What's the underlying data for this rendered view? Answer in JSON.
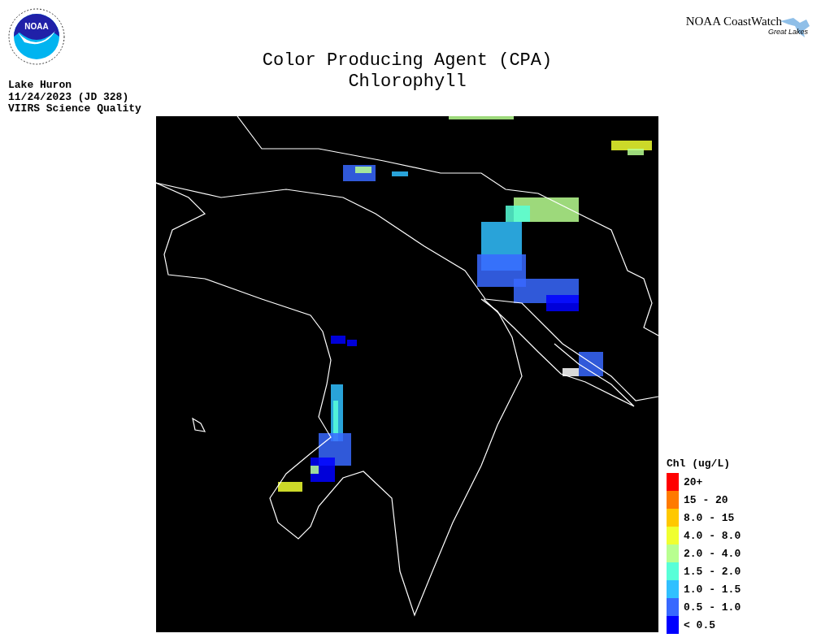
{
  "header": {
    "agency_logo_text": "NOAA",
    "title": "Color Producing Agent (CPA)",
    "subtitle": "Chlorophyll",
    "brand": "NOAA CoastWatch",
    "brand_sub": "Great Lakes"
  },
  "info": [
    "Lake Huron",
    "11/24/2023 (JD 328)",
    "VIIRS Science Quality"
  ],
  "legend": {
    "title": "Chl (ug/L)",
    "items": [
      {
        "label": "20+",
        "color": "#ff0000"
      },
      {
        "label": "15 - 20",
        "color": "#ff7a00"
      },
      {
        "label": "8.0 - 15",
        "color": "#ffc800"
      },
      {
        "label": "4.0 - 8.0",
        "color": "#f0ff30"
      },
      {
        "label": "2.0 - 4.0",
        "color": "#b8ff90"
      },
      {
        "label": "1.5 - 2.0",
        "color": "#58ffd8"
      },
      {
        "label": "1.0 - 1.5",
        "color": "#30c0ff"
      },
      {
        "label": "0.5 - 1.0",
        "color": "#3868ff"
      },
      {
        "label": "< 0.5",
        "color": "#0000ff"
      }
    ]
  }
}
